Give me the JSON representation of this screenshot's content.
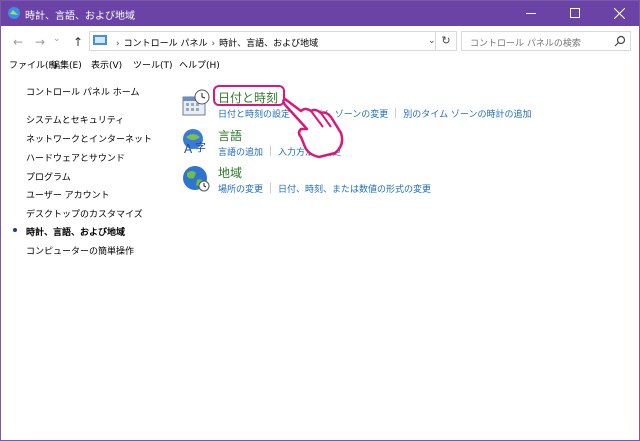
{
  "window": {
    "title": "時計、言語、および地域",
    "minimize": "minimize",
    "maximize": "maximize",
    "close": "close"
  },
  "nav": {
    "back": "←",
    "forward": "→",
    "recent": "⌄",
    "up": "↑"
  },
  "address": {
    "crumbs": [
      "コントロール パネル",
      "時計、言語、および地域"
    ],
    "sep": "›"
  },
  "search": {
    "placeholder": "コントロール パネルの検索"
  },
  "menu": [
    "ファイル(F)",
    "編集(E)",
    "表示(V)",
    "ツール(T)",
    "ヘルプ(H)"
  ],
  "sidebar": {
    "items": [
      "コントロール パネル ホーム",
      "システムとセキュリティ",
      "ネットワークとインターネット",
      "ハードウェアとサウンド",
      "プログラム",
      "ユーザー アカウント",
      "デスクトップのカスタマイズ",
      "時計、言語、および地域",
      "コンピューターの簡単操作"
    ],
    "current_index": 7
  },
  "categories": [
    {
      "title": "日付と時刻",
      "links": [
        "日付と時刻の設定",
        "タイム ゾーンの変更",
        "別のタイム ゾーンの時計の追加"
      ]
    },
    {
      "title": "言語",
      "links": [
        "言語の追加",
        "入力方法の変更"
      ]
    },
    {
      "title": "地域",
      "links": [
        "場所の変更",
        "日付、時刻、または数値の形式の変更"
      ]
    }
  ],
  "colors": {
    "titlebar": "#6b43a6",
    "link": "#1e6dbf",
    "category_title": "#2c7a2c",
    "highlight": "#d9197a"
  }
}
